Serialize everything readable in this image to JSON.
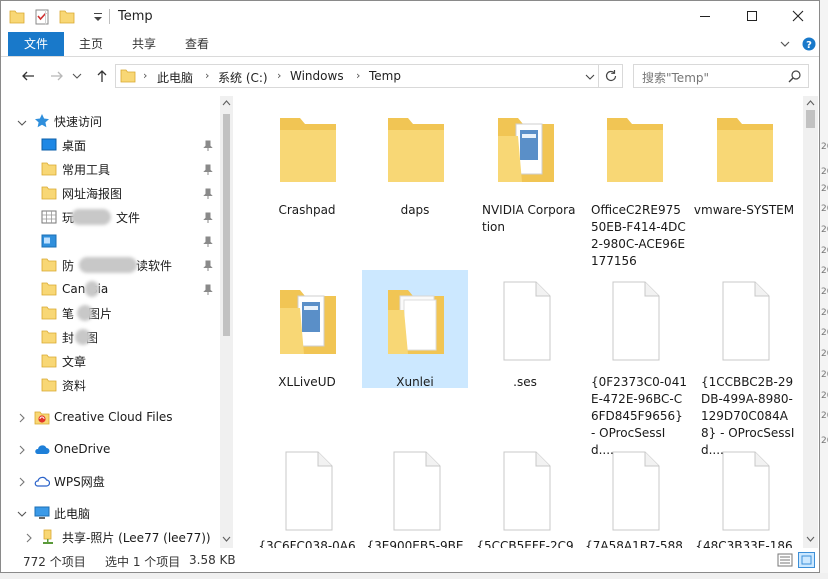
{
  "window": {
    "title": "Temp",
    "colors": {
      "accent": "#1979ca",
      "folder": "#f8d775",
      "selection": "#cce8ff"
    }
  },
  "ribbon": {
    "tabs": [
      {
        "label": "文件"
      },
      {
        "label": "主页"
      },
      {
        "label": "共享"
      },
      {
        "label": "查看"
      }
    ]
  },
  "address": {
    "crumbs": [
      "此电脑",
      "系统 (C:)",
      "Windows",
      "Temp"
    ],
    "search_placeholder": "搜索\"Temp\""
  },
  "sidebar": {
    "quick_access_label": "快速访问",
    "items": [
      {
        "label": "桌面",
        "icon": "desktop-icon",
        "pinned": true
      },
      {
        "label": "常用工具",
        "icon": "folder-icon",
        "pinned": true
      },
      {
        "label": "网址海报图",
        "icon": "folder-icon",
        "pinned": true
      },
      {
        "label": "玩",
        "suffix": "文件",
        "icon": "grid-icon",
        "pinned": true
      },
      {
        "label": "",
        "icon": "image-icon",
        "pinned": true
      },
      {
        "label": "防",
        "suffix": "读软件",
        "icon": "folder-icon",
        "pinned": true
      },
      {
        "label": "Can",
        "suffix": "sia",
        "icon": "folder-icon",
        "pinned": true
      },
      {
        "label": "笔",
        "suffix": "图片",
        "icon": "folder-icon",
        "pinned": false
      },
      {
        "label": "封",
        "suffix": "图",
        "icon": "folder-icon",
        "pinned": false
      },
      {
        "label": "文章",
        "icon": "folder-icon",
        "pinned": false
      },
      {
        "label": "资料",
        "icon": "folder-icon",
        "pinned": false
      }
    ],
    "creative_cloud": "Creative Cloud Files",
    "onedrive": "OneDrive",
    "wps": "WPS网盘",
    "this_pc": "此电脑",
    "shared_photos": "共享-照片 (Lee77 (lee77))"
  },
  "files": {
    "row1": [
      {
        "name": "Crashpad",
        "type": "folder"
      },
      {
        "name": "daps",
        "type": "folder"
      },
      {
        "name": "NVIDIA Corporation",
        "type": "folder-docs"
      },
      {
        "name": "OfficeC2RE97550EB-F414-4DC2-980C-ACE96E177156",
        "type": "folder"
      },
      {
        "name": "vmware-SYSTEM",
        "type": "folder"
      }
    ],
    "row2": [
      {
        "name": "XLLiveUD",
        "type": "folder-docs"
      },
      {
        "name": "Xunlei",
        "type": "folder-open",
        "selected": true
      },
      {
        "name": ".ses",
        "type": "file"
      },
      {
        "name": "{0F2373C0-041E-472E-96BC-C6FD845F9656} - OProcSessId....",
        "type": "file"
      },
      {
        "name": "{1CCBBC2B-29DB-499A-8980-129D70C084A8} - OProcSessId....",
        "type": "file"
      }
    ],
    "row3": [
      {
        "name": "{3C6FC038-0A6",
        "type": "file"
      },
      {
        "name": "{3E900EB5-9BE5",
        "type": "file"
      },
      {
        "name": "{5CCB5EFF-2C9",
        "type": "file"
      },
      {
        "name": "{7A58A1B7-588",
        "type": "file"
      },
      {
        "name": "{48C3B33E-186",
        "type": "file"
      }
    ]
  },
  "status": {
    "count": "772 个项目",
    "selected": "选中 1 个项目",
    "size": "3.58 KB"
  },
  "background_dates": [
    "20",
    "20",
    "20",
    "20",
    "20",
    "20",
    "20",
    "20",
    "20",
    "20",
    "20",
    "20",
    "20",
    "20",
    "20"
  ]
}
